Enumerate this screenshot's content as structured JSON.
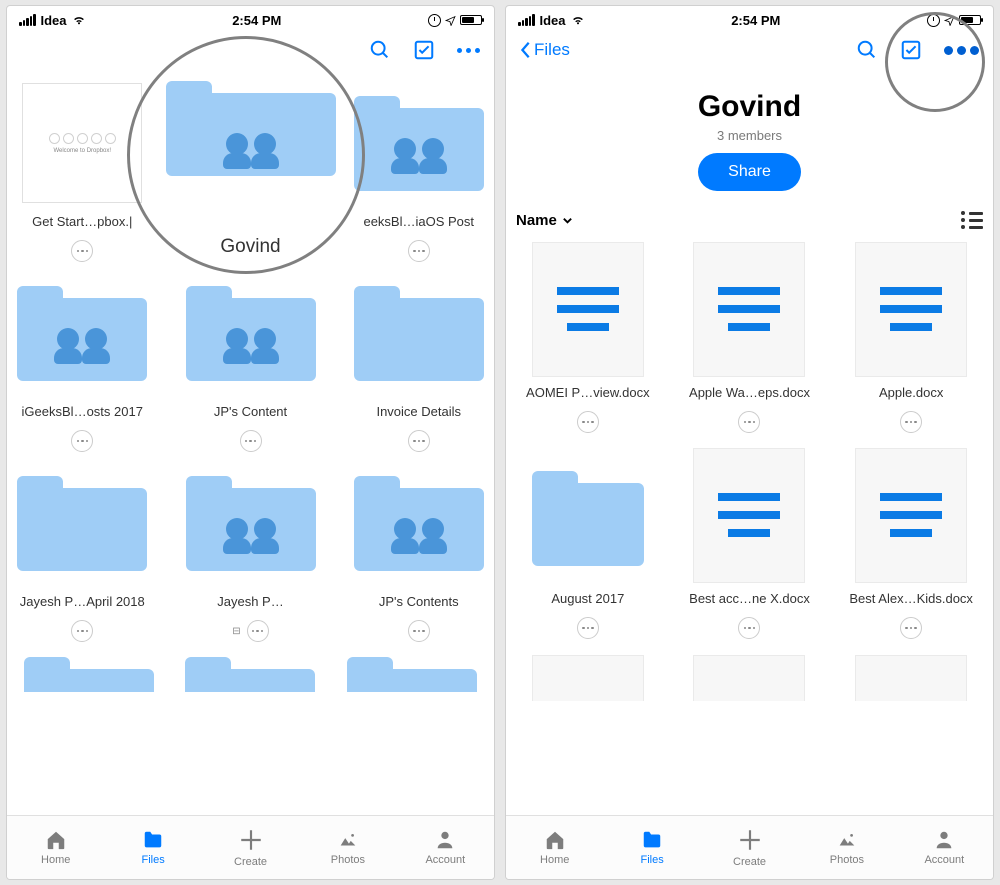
{
  "status": {
    "carrier": "Idea",
    "time": "2:54 PM"
  },
  "navBack": "Files",
  "left": {
    "items": [
      {
        "name": "Get Start…pbox.|",
        "kind": "pdf"
      },
      {
        "name": "Govind",
        "kind": "shared"
      },
      {
        "name": "eeksBl…iaOS Post",
        "kind": "shared"
      },
      {
        "name": "iGeeksBl…osts 2017",
        "kind": "shared"
      },
      {
        "name": "JP's Content",
        "kind": "shared"
      },
      {
        "name": "Invoice Details",
        "kind": "folder"
      },
      {
        "name": "Jayesh P…April 2018",
        "kind": "folder"
      },
      {
        "name": "Jayesh P…",
        "kind": "shared",
        "hasStar": true
      },
      {
        "name": "JP's Contents",
        "kind": "shared"
      }
    ]
  },
  "right": {
    "title": "Govind",
    "members": "3 members",
    "share": "Share",
    "sort": "Name",
    "items": [
      {
        "name": "AOMEI P…view.docx",
        "kind": "doc"
      },
      {
        "name": "Apple Wa…eps.docx",
        "kind": "doc"
      },
      {
        "name": "Apple.docx",
        "kind": "doc"
      },
      {
        "name": "August 2017",
        "kind": "folder"
      },
      {
        "name": "Best acc…ne X.docx",
        "kind": "doc"
      },
      {
        "name": "Best Alex…Kids.docx",
        "kind": "doc"
      }
    ]
  },
  "tabs": {
    "home": "Home",
    "files": "Files",
    "create": "Create",
    "photos": "Photos",
    "account": "Account"
  }
}
